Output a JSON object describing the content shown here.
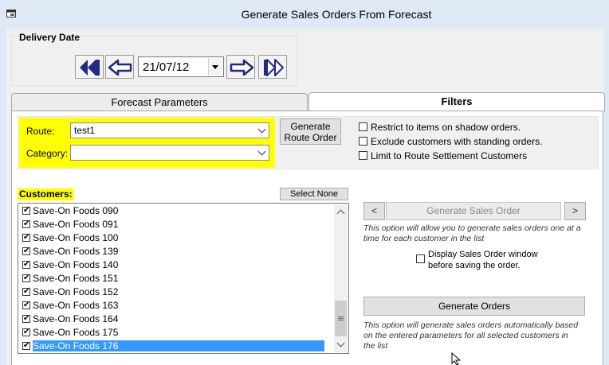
{
  "window": {
    "title": "Generate Sales Orders From Forecast"
  },
  "delivery": {
    "label": "Delivery Date",
    "date": "21/07/12"
  },
  "tabs": [
    {
      "label": "Forecast Parameters",
      "active": false
    },
    {
      "label": "Filters",
      "active": true
    }
  ],
  "filters": {
    "route_label": "Route:",
    "route_value": "test1",
    "category_label": "Category:",
    "category_value": "",
    "generate_route_line1": "Generate",
    "generate_route_line2": "Route Order",
    "options": [
      {
        "label": "Restrict to items on shadow orders.",
        "checked": false
      },
      {
        "label": "Exclude customers with standing orders.",
        "checked": false
      },
      {
        "label": "Limit to Route Settlement Customers",
        "checked": false
      }
    ]
  },
  "customers": {
    "label": "Customers:",
    "select_none": "Select None",
    "items": [
      {
        "name": "Save-On Foods 090",
        "checked": true,
        "selected": false
      },
      {
        "name": "Save-On Foods 091",
        "checked": true,
        "selected": false
      },
      {
        "name": "Save-On Foods 100",
        "checked": true,
        "selected": false
      },
      {
        "name": "Save-On Foods 139",
        "checked": true,
        "selected": false
      },
      {
        "name": "Save-On Foods 140",
        "checked": true,
        "selected": false
      },
      {
        "name": "Save-On Foods 151",
        "checked": true,
        "selected": false
      },
      {
        "name": "Save-On Foods 152",
        "checked": true,
        "selected": false
      },
      {
        "name": "Save-On Foods 163",
        "checked": true,
        "selected": false
      },
      {
        "name": "Save-On Foods 164",
        "checked": true,
        "selected": false
      },
      {
        "name": "Save-On Foods 175",
        "checked": true,
        "selected": false
      },
      {
        "name": "Save-On Foods 176",
        "checked": true,
        "selected": true
      }
    ]
  },
  "generate": {
    "prev": "<",
    "next": ">",
    "sales_order_label": "Generate Sales Order",
    "sales_order_desc": "This option will allow you to generate sales orders one at a time for each customer in the list",
    "display_label_1": "Display Sales Order window",
    "display_label_2": "before saving the order.",
    "display_checked": false,
    "orders_label": "Generate Orders",
    "orders_desc": "This option will generate sales orders automatically based on the entered parameters for all selected customers in the list"
  }
}
